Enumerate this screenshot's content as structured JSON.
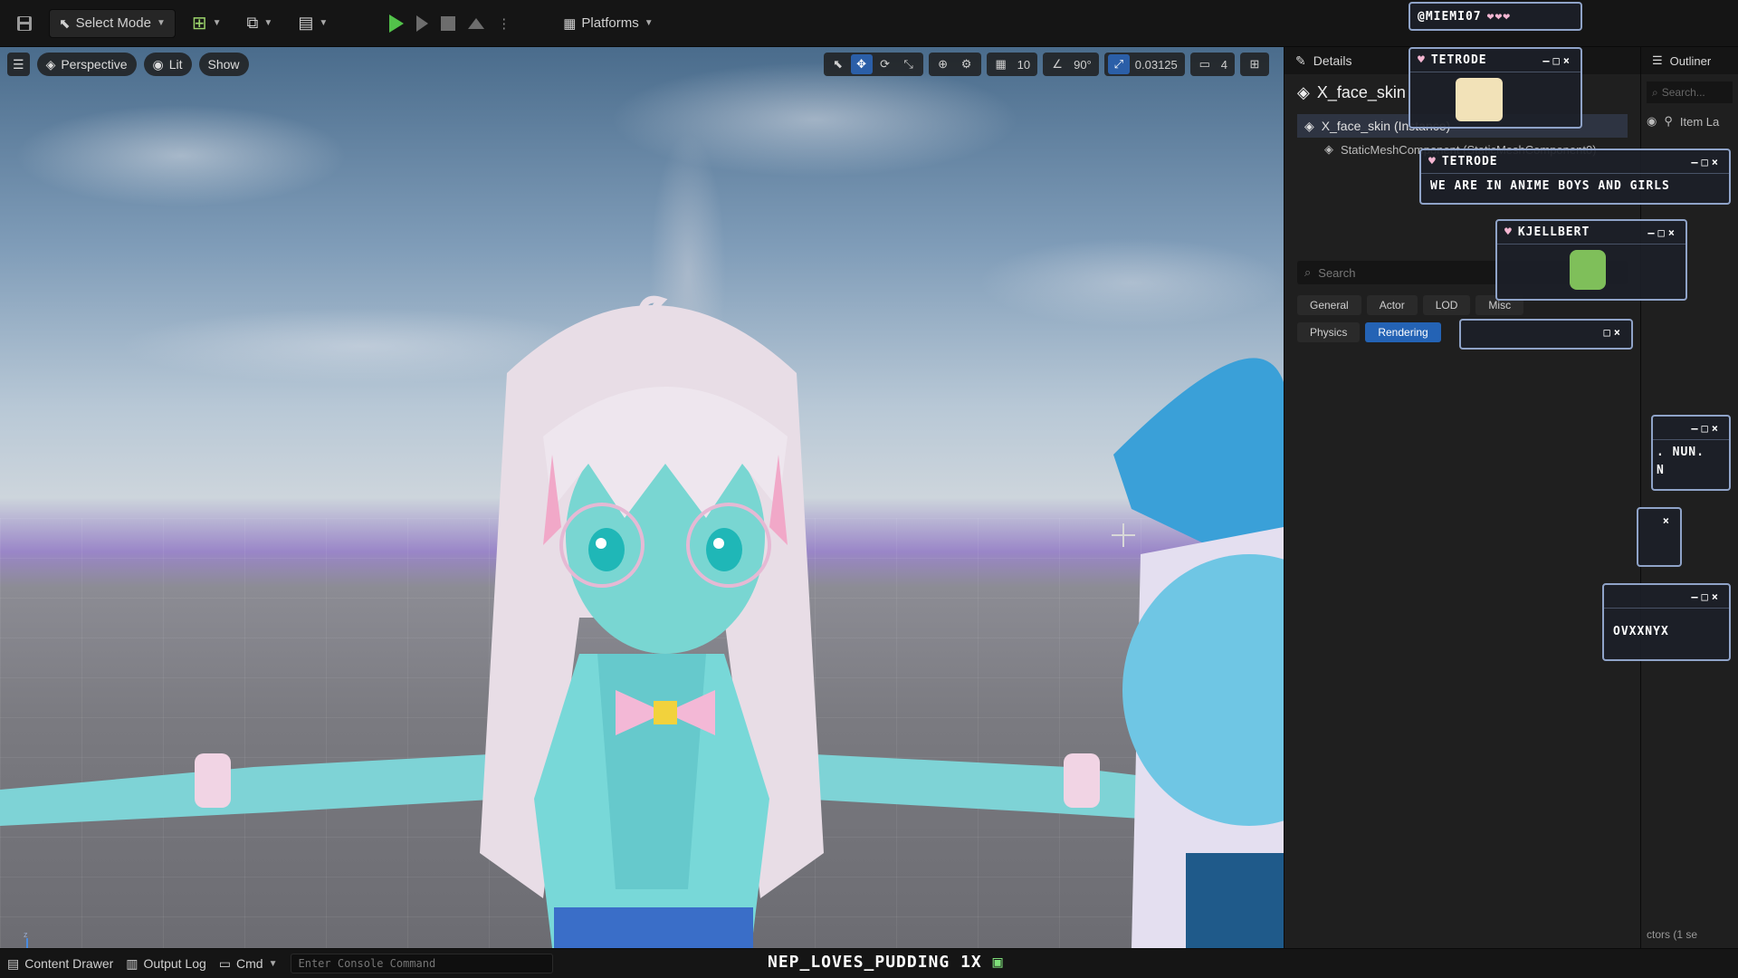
{
  "toolbar": {
    "select_mode": "Select Mode",
    "platforms": "Platforms"
  },
  "viewport": {
    "perspective": "Perspective",
    "lit": "Lit",
    "show": "Show",
    "grid_snap": "10",
    "angle_snap": "90°",
    "scale_snap": "0.03125",
    "camera_speed": "4"
  },
  "details": {
    "tab": "Details",
    "actor_name": "X_face_skin",
    "instance_label": "X_face_skin (Instance)",
    "component_label": "StaticMeshComponent (StaticMeshComponent0)",
    "search_placeholder": "Search",
    "filter_tabs": [
      "General",
      "Actor",
      "LOD",
      "Misc",
      "Physics",
      "Rendering"
    ],
    "selected_filter": "Rendering"
  },
  "outliner": {
    "tab": "Outliner",
    "search_placeholder": "Search...",
    "column": "Item La",
    "footer": "ctors (1 se"
  },
  "overlays": {
    "top_user": "@MIEMI07",
    "card1_user": "TETRODE",
    "card2_user": "TETRODE",
    "card2_message": "WE ARE IN ANIME BOYS AND GIRLS",
    "card3_user": "KJELLBERT",
    "card5_message_a": ". NUN.",
    "card5_message_b": "N",
    "card7_message": "OVXXNYX"
  },
  "bottom": {
    "content_drawer": "Content Drawer",
    "output_log": "Output Log",
    "cmd": "Cmd",
    "console_placeholder": "Enter Console Command",
    "ticker": "NEP_LOVES_PUDDING 1X"
  },
  "colors": {
    "accent": "#2463b5",
    "play": "#52c24a"
  }
}
